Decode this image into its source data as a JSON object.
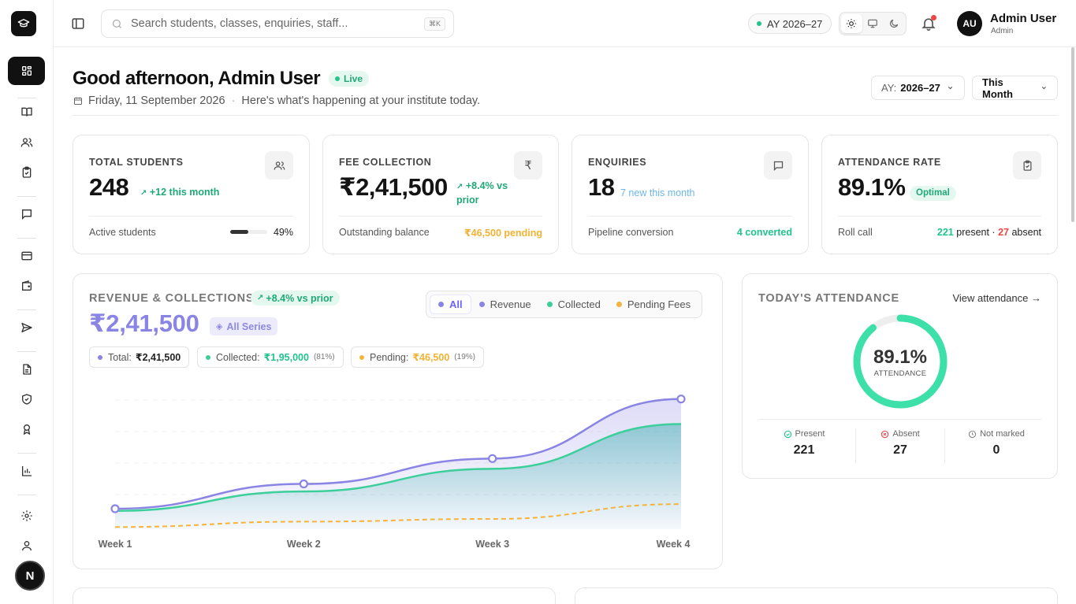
{
  "sidebar": {
    "items": [
      {
        "name": "dashboard",
        "icon": "grid-icon",
        "active": true
      },
      {
        "name": "courses",
        "icon": "book-icon"
      },
      {
        "name": "students",
        "icon": "users-icon"
      },
      {
        "name": "attendance",
        "icon": "clipboard-check-icon"
      },
      {
        "name": "enquiries",
        "icon": "message-icon"
      },
      {
        "name": "fees",
        "icon": "credit-card-icon"
      },
      {
        "name": "wallet",
        "icon": "wallet-icon"
      },
      {
        "name": "communications",
        "icon": "send-icon"
      },
      {
        "name": "documents",
        "icon": "file-icon"
      },
      {
        "name": "security",
        "icon": "shield-icon"
      },
      {
        "name": "certificates",
        "icon": "award-icon"
      },
      {
        "name": "reports",
        "icon": "bar-chart-icon"
      },
      {
        "name": "settings",
        "icon": "gear-icon"
      },
      {
        "name": "profile",
        "icon": "user-icon"
      }
    ],
    "badge_letter": "N"
  },
  "topbar": {
    "search_placeholder": "Search students, classes, enquiries, staff...",
    "search_shortcut": "⌘K",
    "academic_year": "AY 2026–27",
    "user_initials": "AU",
    "user_name": "Admin User",
    "user_role": "Admin"
  },
  "header": {
    "greeting": "Good afternoon, Admin User",
    "live_label": "Live",
    "date": "Friday, 11 September 2026",
    "subtitle": "Here's what's happening at your institute today.",
    "ay_label": "AY:",
    "ay_value": "2026–27",
    "period": "This Month"
  },
  "stats": {
    "students": {
      "label": "TOTAL STUDENTS",
      "value": "248",
      "delta": "+12 this month",
      "foot_label": "Active students",
      "foot_value": "49%",
      "progress": 0.49
    },
    "fees": {
      "label": "FEE COLLECTION",
      "value": "₹2,41,500",
      "delta_line1": "+8.4% vs",
      "delta_line2": "prior",
      "foot_label": "Outstanding balance",
      "foot_value": "₹46,500 pending"
    },
    "enquiries": {
      "label": "ENQUIRIES",
      "value": "18",
      "delta": "7 new this month",
      "foot_label": "Pipeline conversion",
      "foot_value": "4 converted"
    },
    "attendance": {
      "label": "ATTENDANCE RATE",
      "value": "89.1%",
      "badge": "Optimal",
      "foot_label": "Roll call",
      "present": "221",
      "present_label": "present ·",
      "absent": "27",
      "absent_label": "absent"
    }
  },
  "revenue": {
    "title": "REVENUE & COLLECTIONS",
    "badge": "+8.4% vs prior",
    "total": "₹2,41,500",
    "all_series": "All Series",
    "filters": [
      "All",
      "Revenue",
      "Collected",
      "Pending Fees"
    ],
    "chips": {
      "total_label": "Total:",
      "total_value": "₹2,41,500",
      "collected_label": "Collected:",
      "collected_value": "₹1,95,000",
      "collected_pct": "(81%)",
      "pending_label": "Pending:",
      "pending_value": "₹46,500",
      "pending_pct": "(19%)"
    }
  },
  "chart_data": {
    "type": "area",
    "categories": [
      "Week 1",
      "Week 2",
      "Week 3",
      "Week 4"
    ],
    "series": [
      {
        "name": "Revenue",
        "values": [
          38000,
          84000,
          131000,
          241500
        ],
        "color": "#8a84e4"
      },
      {
        "name": "Collected",
        "values": [
          34000,
          70000,
          112000,
          195000
        ],
        "color": "#3ccf9a"
      },
      {
        "name": "Pending Fees",
        "values": [
          4000,
          14000,
          19000,
          46500
        ],
        "color": "#f5b43c"
      }
    ],
    "grid": true,
    "legend": "top-right"
  },
  "today_attendance": {
    "title": "TODAY'S ATTENDANCE",
    "link": "View attendance",
    "percent": "89.1%",
    "percent_value": 0.891,
    "sub": "ATTENDANCE",
    "present_label": "Present",
    "present": "221",
    "absent_label": "Absent",
    "absent": "27",
    "unmarked_label": "Not marked",
    "unmarked": "0"
  },
  "colors": {
    "accent": "#8a84e4",
    "green": "#22c38e",
    "amber": "#f5b43c",
    "red": "#ef4444",
    "dark": "#111111"
  }
}
